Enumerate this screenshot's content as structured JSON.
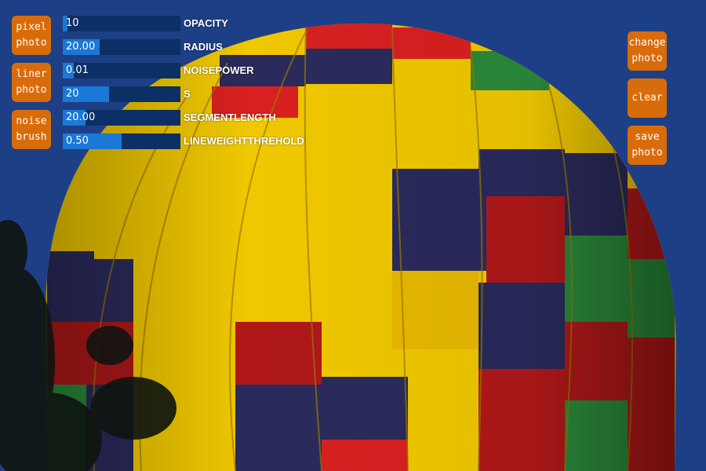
{
  "left_buttons": [
    {
      "label": "pixel\nphoto"
    },
    {
      "label": "liner\nphoto"
    },
    {
      "label": "noise\nbrush"
    }
  ],
  "right_buttons": [
    {
      "label": "change\nphoto"
    },
    {
      "label": "clear"
    },
    {
      "label": "save\nphoto"
    }
  ],
  "sliders": [
    {
      "value": "10",
      "label": "OPACITY",
      "fraction": 0.04
    },
    {
      "value": "20.00",
      "label": "RADIUS",
      "fraction": 0.31
    },
    {
      "value": "0.01",
      "label": "NOISEPOWER",
      "fraction": 0.09
    },
    {
      "value": "20",
      "label": "S",
      "fraction": 0.39
    },
    {
      "value": "20.00",
      "label": "SEGMENTLENGTH",
      "fraction": 0.19
    },
    {
      "value": "0.50",
      "label": "LINEWEIGHTTHREHOLD",
      "fraction": 0.5
    }
  ],
  "colors": {
    "button": "#d96c0a",
    "slider_track": "#0c2f66",
    "slider_fill": "#1a78d6",
    "sky": "#1d3f86"
  },
  "canvas_image": "hot-air-balloon-photo"
}
